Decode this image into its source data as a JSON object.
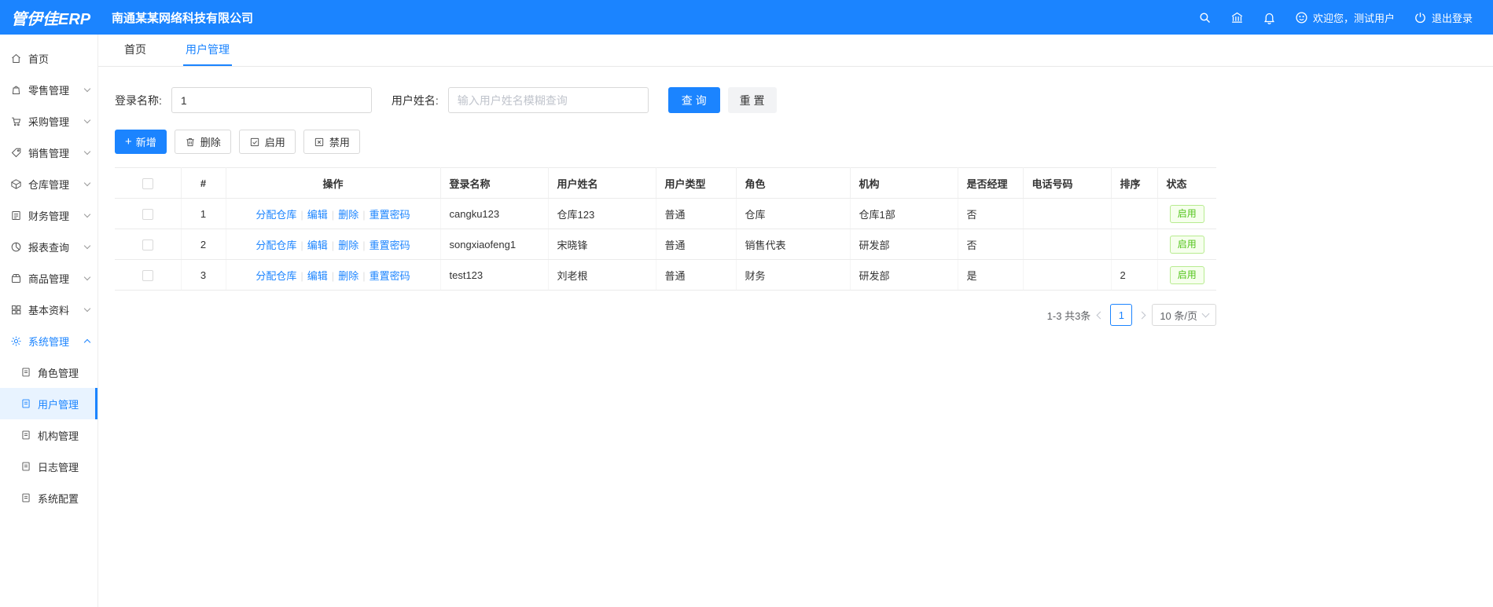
{
  "topbar": {
    "logo": "管伊佳ERP",
    "company": "南通某某网络科技有限公司",
    "welcome": "欢迎您，测试用户",
    "logout": "退出登录",
    "icons": [
      "search-icon",
      "bank-icon",
      "bell-icon",
      "smile-icon",
      "power-icon"
    ]
  },
  "sidebar": {
    "items": [
      {
        "label": "首页",
        "icon": "home-icon"
      },
      {
        "label": "零售管理",
        "icon": "retail-icon"
      },
      {
        "label": "采购管理",
        "icon": "purchase-icon"
      },
      {
        "label": "销售管理",
        "icon": "sales-icon"
      },
      {
        "label": "仓库管理",
        "icon": "warehouse-icon"
      },
      {
        "label": "财务管理",
        "icon": "finance-icon"
      },
      {
        "label": "报表查询",
        "icon": "report-icon"
      },
      {
        "label": "商品管理",
        "icon": "goods-icon"
      },
      {
        "label": "基本资料",
        "icon": "basic-icon"
      },
      {
        "label": "系统管理",
        "icon": "system-icon"
      }
    ],
    "sub_items": [
      "角色管理",
      "用户管理",
      "机构管理",
      "日志管理",
      "系统配置"
    ],
    "active_sub": "用户管理"
  },
  "tabs": [
    {
      "label": "首页"
    },
    {
      "label": "用户管理"
    }
  ],
  "filters": {
    "login_label": "登录名称:",
    "login_value": "1",
    "name_label": "用户姓名:",
    "name_placeholder": "输入用户姓名模糊查询",
    "search": "查 询",
    "reset": "重 置"
  },
  "toolbar": {
    "add": "新增",
    "delete": "删除",
    "enable": "启用",
    "disable": "禁用"
  },
  "table": {
    "headers": [
      "#",
      "操作",
      "登录名称",
      "用户姓名",
      "用户类型",
      "角色",
      "机构",
      "是否经理",
      "电话号码",
      "排序",
      "状态"
    ],
    "action_links": [
      "分配仓库",
      "编辑",
      "删除",
      "重置密码"
    ],
    "rows": [
      {
        "num": "1",
        "login": "cangku123",
        "name": "仓库123",
        "type": "普通",
        "role": "仓库",
        "org": "仓库1部",
        "manager": "否",
        "phone": "",
        "sort": "",
        "status": "启用"
      },
      {
        "num": "2",
        "login": "songxiaofeng1",
        "name": "宋晓锋",
        "type": "普通",
        "role": "销售代表",
        "org": "研发部",
        "manager": "否",
        "phone": "",
        "sort": "",
        "status": "启用"
      },
      {
        "num": "3",
        "login": "test123",
        "name": "刘老根",
        "type": "普通",
        "role": "财务",
        "org": "研发部",
        "manager": "是",
        "phone": "",
        "sort": "2",
        "status": "启用"
      }
    ]
  },
  "pagination": {
    "range_text": "1-3 共3条",
    "current_page": "1",
    "page_size_label": "10 条/页"
  }
}
